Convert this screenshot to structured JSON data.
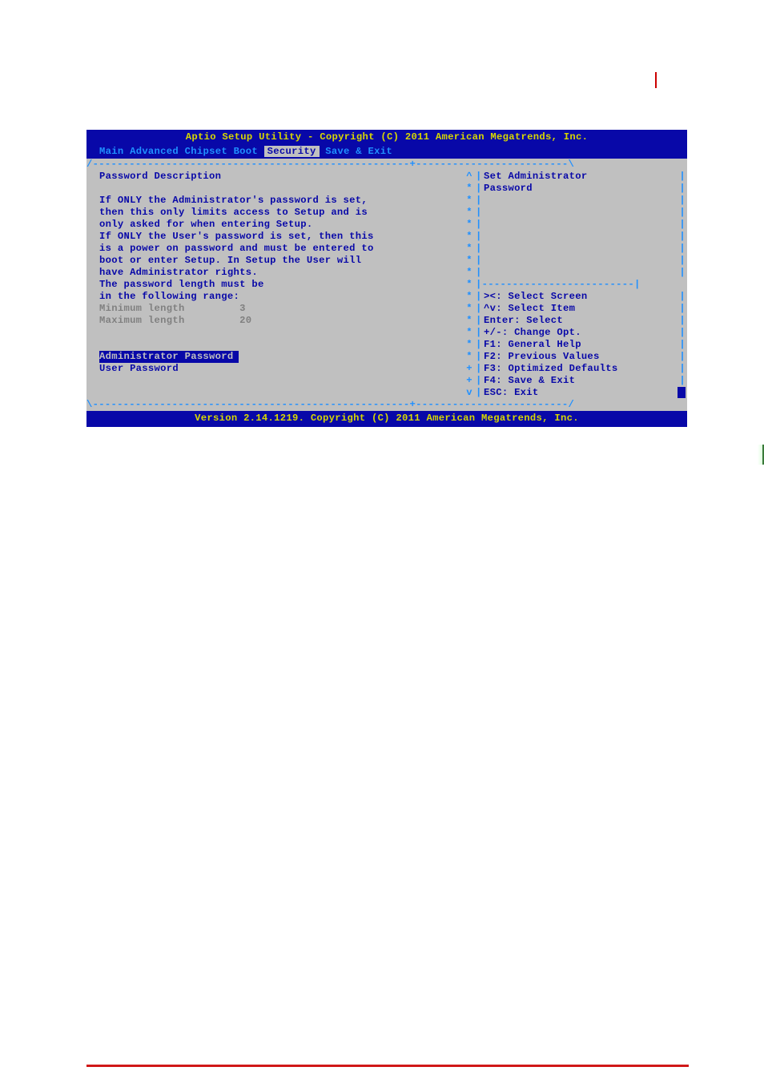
{
  "header": {
    "title": "Aptio Setup Utility - Copyright (C) 2011 American Megatrends, Inc."
  },
  "menu": {
    "items": [
      "Main",
      "Advanced",
      "Chipset",
      "Boot",
      "Security",
      "Save & Exit"
    ],
    "selected_index": 4
  },
  "main_panel": {
    "heading": "Password Description",
    "desc_lines": [
      "If ONLY the Administrator's password is set,",
      "then this only limits access to Setup and is",
      "only asked for when entering Setup.",
      "If ONLY the User's password is set, then this",
      "is a power on password and must be entered to",
      "boot or enter Setup. In Setup the User will",
      "have Administrator rights.",
      "The password length must be",
      "in the following range:"
    ],
    "min_label": "Minimum length",
    "min_value": "3",
    "max_label": "Maximum length",
    "max_value": "20",
    "admin_item": "Administrator Password",
    "user_item": "User Password"
  },
  "help_panel": {
    "item_help": [
      "Set Administrator",
      "Password"
    ],
    "keys": [
      "><: Select Screen",
      "^v: Select Item",
      "Enter: Select",
      "+/-: Change Opt.",
      "F1: General Help",
      "F2: Previous Values",
      "F3: Optimized Defaults",
      "F4: Save & Exit",
      "ESC: Exit"
    ]
  },
  "footer": {
    "version": "Version 2.14.1219. Copyright (C) 2011 American Megatrends, Inc."
  }
}
